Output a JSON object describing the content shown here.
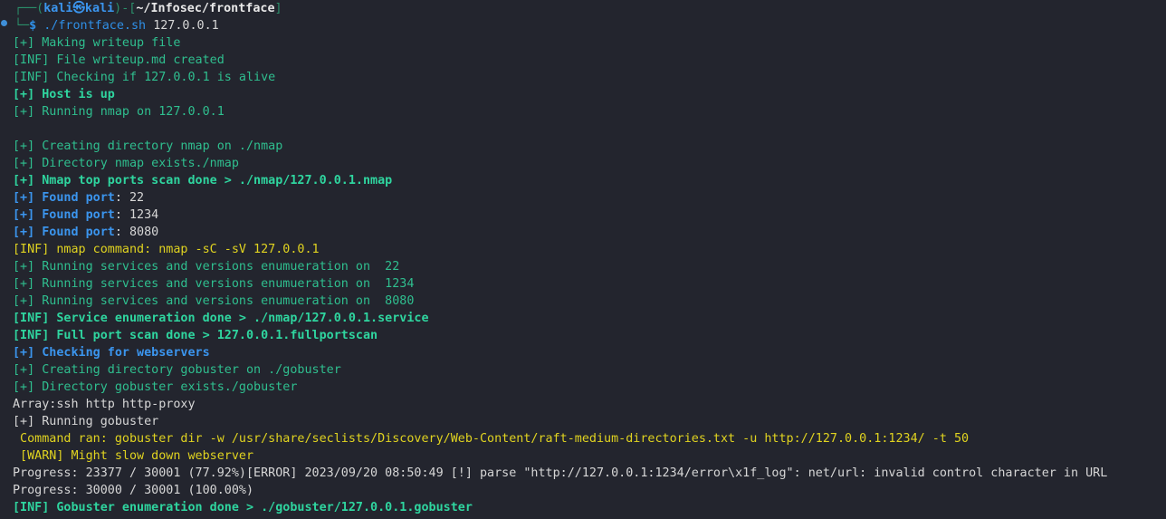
{
  "prompt": {
    "frame_top_left": "┌──(",
    "user": "kali㉿kali",
    "frame_mid": ")-[",
    "cwd": "~/Infosec/frontface",
    "frame_end": "]",
    "frame_bottom": "└─",
    "dollar": "$",
    "command": "./frontface.sh",
    "argument": "127.0.0.1"
  },
  "lines": {
    "l01": "[+] Making writeup file",
    "l02": "[INF] File writeup.md created",
    "l03": "[INF] Checking if 127.0.0.1 is alive",
    "l04": "[+] Host is up",
    "l05": "[+] Running nmap on 127.0.0.1",
    "l06": "[+] Creating directory nmap on ./nmap",
    "l07": "[+] Directory nmap exists./nmap",
    "l08": "[+] Nmap top ports scan done > ./nmap/127.0.0.1.nmap",
    "l09a": "[+] Found port",
    "l09b": ": 22",
    "l10a": "[+] Found port",
    "l10b": ": 1234",
    "l11a": "[+] Found port",
    "l11b": ": 8080",
    "l12": "[INF] nmap command: nmap -sC -sV 127.0.0.1",
    "l13": "[+] Running services and versions enumueration on  22",
    "l14": "[+] Running services and versions enumueration on  1234",
    "l15": "[+] Running services and versions enumueration on  8080",
    "l16": "[INF] Service enumeration done > ./nmap/127.0.0.1.service",
    "l17": "[INF] Full port scan done > 127.0.0.1.fullportscan",
    "l18": "[+] Checking for webservers",
    "l19": "[+] Creating directory gobuster on ./gobuster",
    "l20": "[+] Directory gobuster exists./gobuster",
    "l21": "Array:ssh http http-proxy",
    "l22": "[+] Running gobuster",
    "l23": " Command ran: gobuster dir -w /usr/share/seclists/Discovery/Web-Content/raft-medium-directories.txt -u http://127.0.0.1:1234/ -t 50",
    "l24": " [WARN] Might slow down webserver",
    "l25": "Progress: 23377 / 30001 (77.92%)[ERROR] 2023/09/20 08:50:49 [!] parse \"http://127.0.0.1:1234/error\\x1f_log\": net/url: invalid control character in URL",
    "l26": "Progress: 30000 / 30001 (100.00%)",
    "l27": "[INF] Gobuster enumeration done > ./gobuster/127.0.0.1.gobuster"
  },
  "colors": {
    "background": "#23252e",
    "green": "#2fbf8f",
    "blue": "#2f8fe6",
    "yellow": "#e0d320",
    "text": "#d6d6d6"
  }
}
